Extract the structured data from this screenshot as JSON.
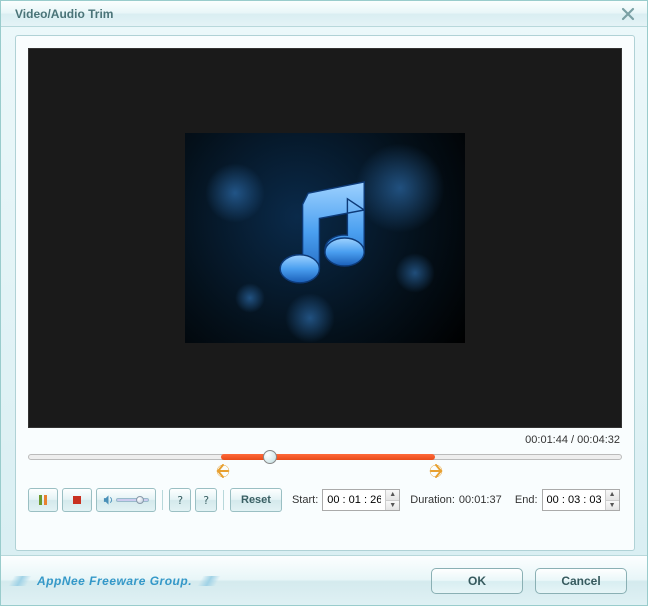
{
  "window": {
    "title": "Video/Audio Trim"
  },
  "playback": {
    "current": "00:01:44",
    "total": "00:04:32"
  },
  "controls": {
    "bracket_left": "?",
    "bracket_right": "?",
    "reset": "Reset"
  },
  "labels": {
    "start": "Start:",
    "duration": "Duration:",
    "end": "End:"
  },
  "values": {
    "start": "00 : 01 : 26",
    "duration": "00:01:37",
    "end": "00 : 03 : 03"
  },
  "footer": {
    "watermark": "AppNee Freeware Group.",
    "ok": "OK",
    "cancel": "Cancel"
  },
  "icons": {
    "close": "close-icon",
    "play_pause": "pause-icon",
    "stop": "stop-icon",
    "volume": "speaker-icon",
    "music_note": "music-note-icon"
  }
}
